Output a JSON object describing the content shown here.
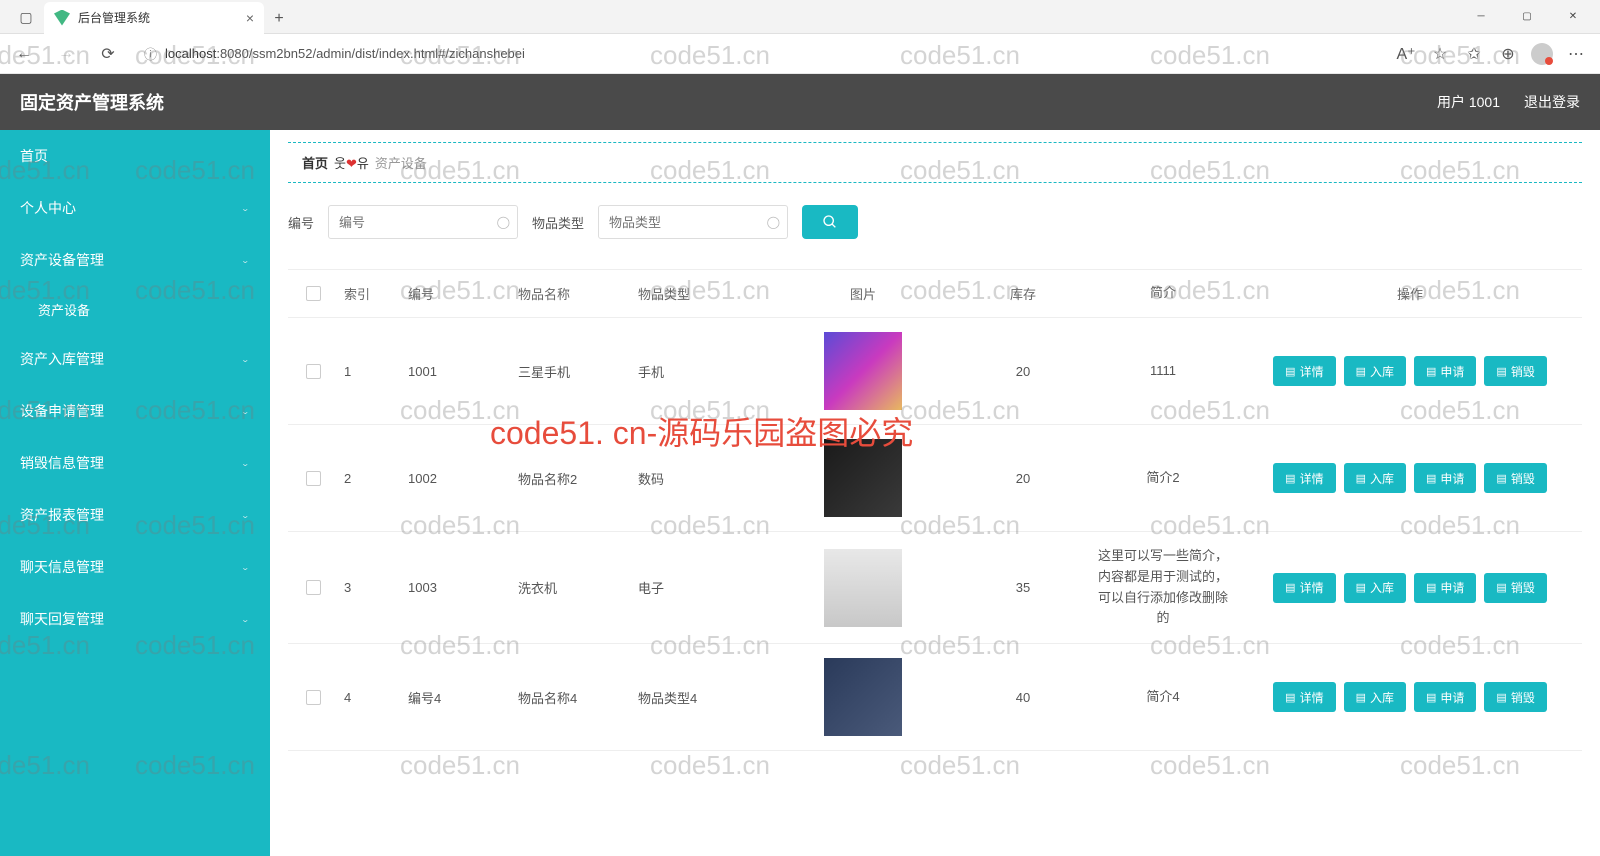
{
  "browser": {
    "tab_title": "后台管理系统",
    "url_host": "localhost",
    "url_path": ":8080/ssm2bn52/admin/dist/index.html#/zichanshebei"
  },
  "header": {
    "app_title": "固定资产管理系统",
    "user": "用户 1001",
    "logout": "退出登录"
  },
  "sidebar": {
    "items": [
      {
        "label": "首页",
        "expandable": false
      },
      {
        "label": "个人中心",
        "expandable": true
      },
      {
        "label": "资产设备管理",
        "expandable": true,
        "sub": "资产设备",
        "open": true
      },
      {
        "label": "资产入库管理",
        "expandable": true
      },
      {
        "label": "设备申请管理",
        "expandable": true
      },
      {
        "label": "销毁信息管理",
        "expandable": true
      },
      {
        "label": "资产报表管理",
        "expandable": true
      },
      {
        "label": "聊天信息管理",
        "expandable": true
      },
      {
        "label": "聊天回复管理",
        "expandable": true
      }
    ]
  },
  "breadcrumb": {
    "home": "首页",
    "emoji": "웃❤유",
    "current": "资产设备"
  },
  "search": {
    "label_num": "编号",
    "ph_num": "编号",
    "label_type": "物品类型",
    "ph_type": "物品类型"
  },
  "table": {
    "headers": {
      "index": "索引",
      "num": "编号",
      "name": "物品名称",
      "type": "物品类型",
      "img": "图片",
      "stock": "库存",
      "intro": "简介",
      "ops": "操作"
    },
    "ops": {
      "detail": "详情",
      "inbound": "入库",
      "apply": "申请",
      "destroy": "销毁"
    },
    "rows": [
      {
        "idx": "1",
        "num": "1001",
        "name": "三星手机",
        "type": "手机",
        "stock": "20",
        "intro": "1111",
        "img": "img1"
      },
      {
        "idx": "2",
        "num": "1002",
        "name": "物品名称2",
        "type": "数码",
        "stock": "20",
        "intro": "简介2",
        "img": "img2"
      },
      {
        "idx": "3",
        "num": "1003",
        "name": "洗衣机",
        "type": "电子",
        "stock": "35",
        "intro": "这里可以写一些简介，内容都是用于测试的，可以自行添加修改删除的",
        "img": "img3"
      },
      {
        "idx": "4",
        "num": "编号4",
        "name": "物品名称4",
        "type": "物品类型4",
        "stock": "40",
        "intro": "简介4",
        "img": "img4"
      }
    ]
  },
  "watermark": {
    "text": "code51.cn",
    "red": "code51. cn-源码乐园盗图必究"
  }
}
